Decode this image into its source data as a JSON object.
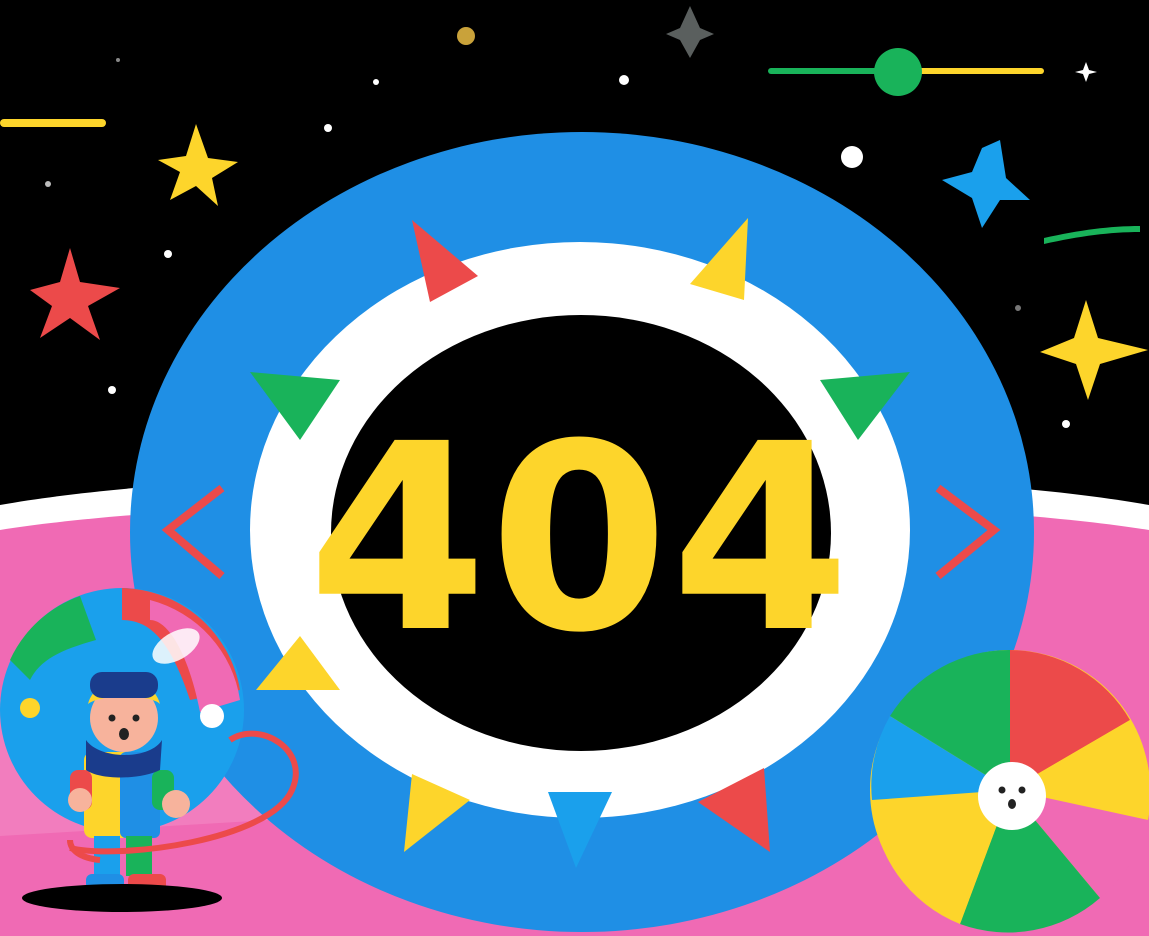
{
  "error": {
    "code": "404"
  },
  "colors": {
    "background": "#000000",
    "ring_blue": "#1f8fe5",
    "ring_white": "#ffffff",
    "code_yellow": "#fdd52b",
    "planet_pink": "#f06ab4",
    "red": "#ec4a4a",
    "green": "#19b35a",
    "yellow": "#fdd52b",
    "blue": "#1aa0ec"
  },
  "icons": {
    "left_arrow": "chevron-left-icon",
    "right_arrow": "chevron-right-icon",
    "character": "astronaut-character",
    "ball": "beach-ball-face"
  }
}
